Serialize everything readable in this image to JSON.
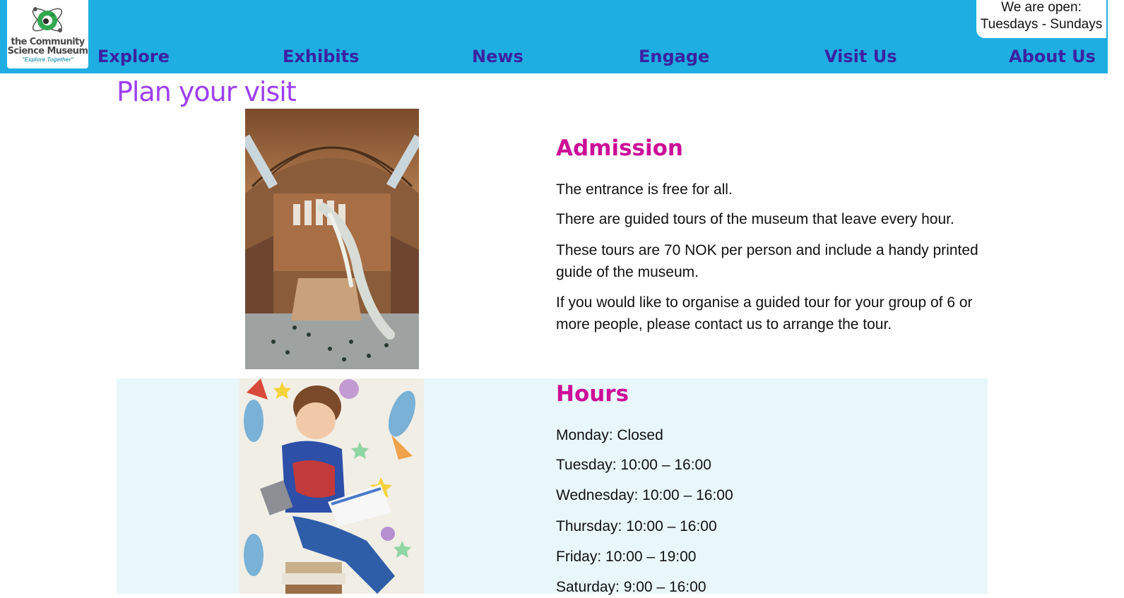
{
  "logo": {
    "line1": "the Community",
    "line2": "Science Museum",
    "tagline": "\"Explore Together\"",
    "icon": "atom-leaf-icon"
  },
  "nav": {
    "items": [
      {
        "label": "Explore"
      },
      {
        "label": "Exhibits"
      },
      {
        "label": "News"
      },
      {
        "label": "Engage"
      },
      {
        "label": "Visit Us"
      },
      {
        "label": "About Us"
      }
    ]
  },
  "opening": {
    "line1": "We are open:",
    "line2": "Tuesdays - Sundays"
  },
  "page": {
    "title": "Plan your visit"
  },
  "admission": {
    "heading": "Admission",
    "paragraphs": [
      "The entrance is free for all.",
      "There are guided tours of the museum that leave every hour.",
      "These tours are 70 NOK per person and include a handy printed guide of the museum.",
      "If you would like to organise a guided tour for your group of 6 or more people, please contact us to arrange the tour."
    ]
  },
  "hours": {
    "heading": "Hours",
    "days": [
      "Monday: Closed",
      "Tuesday: 10:00 – 16:00",
      "Wednesday: 10:00 – 16:00",
      "Thursday: 10:00 – 16:00",
      "Friday: 10:00 – 19:00",
      "Saturday: 9:00 – 16:00"
    ]
  },
  "colors": {
    "header_bg": "#1eaee2",
    "nav_text": "#3b22a0",
    "title": "#9d3ff0",
    "section_heading": "#cc0f98",
    "hours_bg": "#e9f7fb"
  }
}
